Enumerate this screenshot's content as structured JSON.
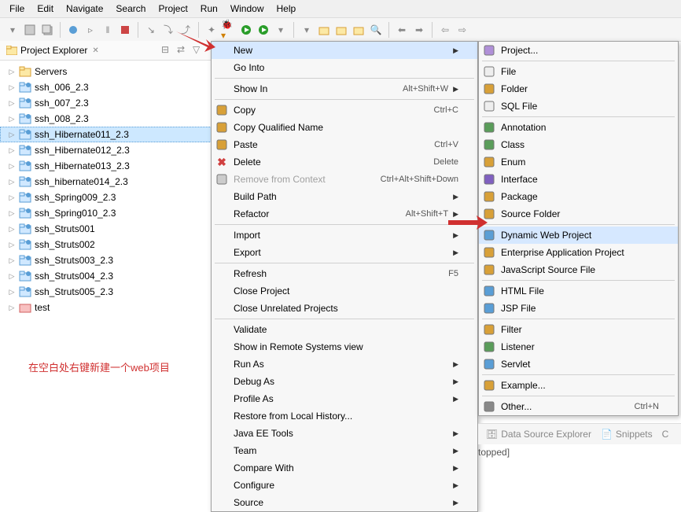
{
  "menubar": [
    "File",
    "Edit",
    "Navigate",
    "Search",
    "Project",
    "Run",
    "Window",
    "Help"
  ],
  "explorer": {
    "title": "Project Explorer",
    "items": [
      {
        "label": "Servers",
        "kind": "servers"
      },
      {
        "label": "ssh_006_2.3",
        "kind": "proj"
      },
      {
        "label": "ssh_007_2.3",
        "kind": "proj"
      },
      {
        "label": "ssh_008_2.3",
        "kind": "proj"
      },
      {
        "label": "ssh_Hibernate011_2.3",
        "kind": "proj",
        "selected": true
      },
      {
        "label": "ssh_Hibernate012_2.3",
        "kind": "proj"
      },
      {
        "label": "ssh_Hibernate013_2.3",
        "kind": "proj"
      },
      {
        "label": "ssh_hibernate014_2.3",
        "kind": "proj"
      },
      {
        "label": "ssh_Spring009_2.3",
        "kind": "proj"
      },
      {
        "label": "ssh_Spring010_2.3",
        "kind": "proj"
      },
      {
        "label": "ssh_Struts001",
        "kind": "proj"
      },
      {
        "label": "ssh_Struts002",
        "kind": "proj"
      },
      {
        "label": "ssh_Struts003_2.3",
        "kind": "proj"
      },
      {
        "label": "ssh_Struts004_2.3",
        "kind": "proj"
      },
      {
        "label": "ssh_Struts005_2.3",
        "kind": "proj"
      },
      {
        "label": "test",
        "kind": "test"
      }
    ]
  },
  "note": "在空白处右键新建一个web项目",
  "contextMenu": [
    {
      "label": "New",
      "arrow": true,
      "highlighted": true
    },
    {
      "label": "Go Into"
    },
    {
      "sep": true
    },
    {
      "label": "Show In",
      "shortcut": "Alt+Shift+W",
      "arrow": true
    },
    {
      "sep": true
    },
    {
      "label": "Copy",
      "shortcut": "Ctrl+C",
      "icon": "copy"
    },
    {
      "label": "Copy Qualified Name",
      "icon": "copy-q"
    },
    {
      "label": "Paste",
      "shortcut": "Ctrl+V",
      "icon": "paste"
    },
    {
      "label": "Delete",
      "shortcut": "Delete",
      "icon": "delete"
    },
    {
      "label": "Remove from Context",
      "shortcut": "Ctrl+Alt+Shift+Down",
      "disabled": true,
      "icon": "remove"
    },
    {
      "label": "Build Path",
      "arrow": true
    },
    {
      "label": "Refactor",
      "shortcut": "Alt+Shift+T",
      "arrow": true
    },
    {
      "sep": true
    },
    {
      "label": "Import",
      "arrow": true
    },
    {
      "label": "Export",
      "arrow": true
    },
    {
      "sep": true
    },
    {
      "label": "Refresh",
      "shortcut": "F5"
    },
    {
      "label": "Close Project"
    },
    {
      "label": "Close Unrelated Projects"
    },
    {
      "sep": true
    },
    {
      "label": "Validate"
    },
    {
      "label": "Show in Remote Systems view"
    },
    {
      "label": "Run As",
      "arrow": true
    },
    {
      "label": "Debug As",
      "arrow": true
    },
    {
      "label": "Profile As",
      "arrow": true
    },
    {
      "label": "Restore from Local History..."
    },
    {
      "label": "Java EE Tools",
      "arrow": true
    },
    {
      "label": "Team",
      "arrow": true
    },
    {
      "label": "Compare With",
      "arrow": true
    },
    {
      "label": "Configure",
      "arrow": true
    },
    {
      "label": "Source",
      "arrow": true
    }
  ],
  "newSubmenu": [
    {
      "label": "Project...",
      "icon": "wizard"
    },
    {
      "sep": true
    },
    {
      "label": "File",
      "icon": "file"
    },
    {
      "label": "Folder",
      "icon": "folder"
    },
    {
      "label": "SQL File",
      "icon": "sql"
    },
    {
      "sep": true
    },
    {
      "label": "Annotation",
      "icon": "annotation"
    },
    {
      "label": "Class",
      "icon": "class"
    },
    {
      "label": "Enum",
      "icon": "enum"
    },
    {
      "label": "Interface",
      "icon": "interface"
    },
    {
      "label": "Package",
      "icon": "package"
    },
    {
      "label": "Source Folder",
      "icon": "srcfolder"
    },
    {
      "sep": true
    },
    {
      "label": "Dynamic Web Project",
      "icon": "web",
      "highlighted": true
    },
    {
      "label": "Enterprise Application Project",
      "icon": "ear"
    },
    {
      "label": "JavaScript Source File",
      "icon": "js"
    },
    {
      "sep": true
    },
    {
      "label": "HTML File",
      "icon": "html"
    },
    {
      "label": "JSP File",
      "icon": "jsp"
    },
    {
      "sep": true
    },
    {
      "label": "Filter",
      "icon": "filter"
    },
    {
      "label": "Listener",
      "icon": "listener"
    },
    {
      "label": "Servlet",
      "icon": "servlet"
    },
    {
      "sep": true
    },
    {
      "label": "Example...",
      "icon": "example"
    },
    {
      "sep": true
    },
    {
      "label": "Other...",
      "shortcut": "Ctrl+N",
      "icon": "other"
    }
  ],
  "bottomTabs": {
    "tab1": "Data Source Explorer",
    "tab2": "Snippets",
    "tab3": "C"
  },
  "status": "topped]"
}
